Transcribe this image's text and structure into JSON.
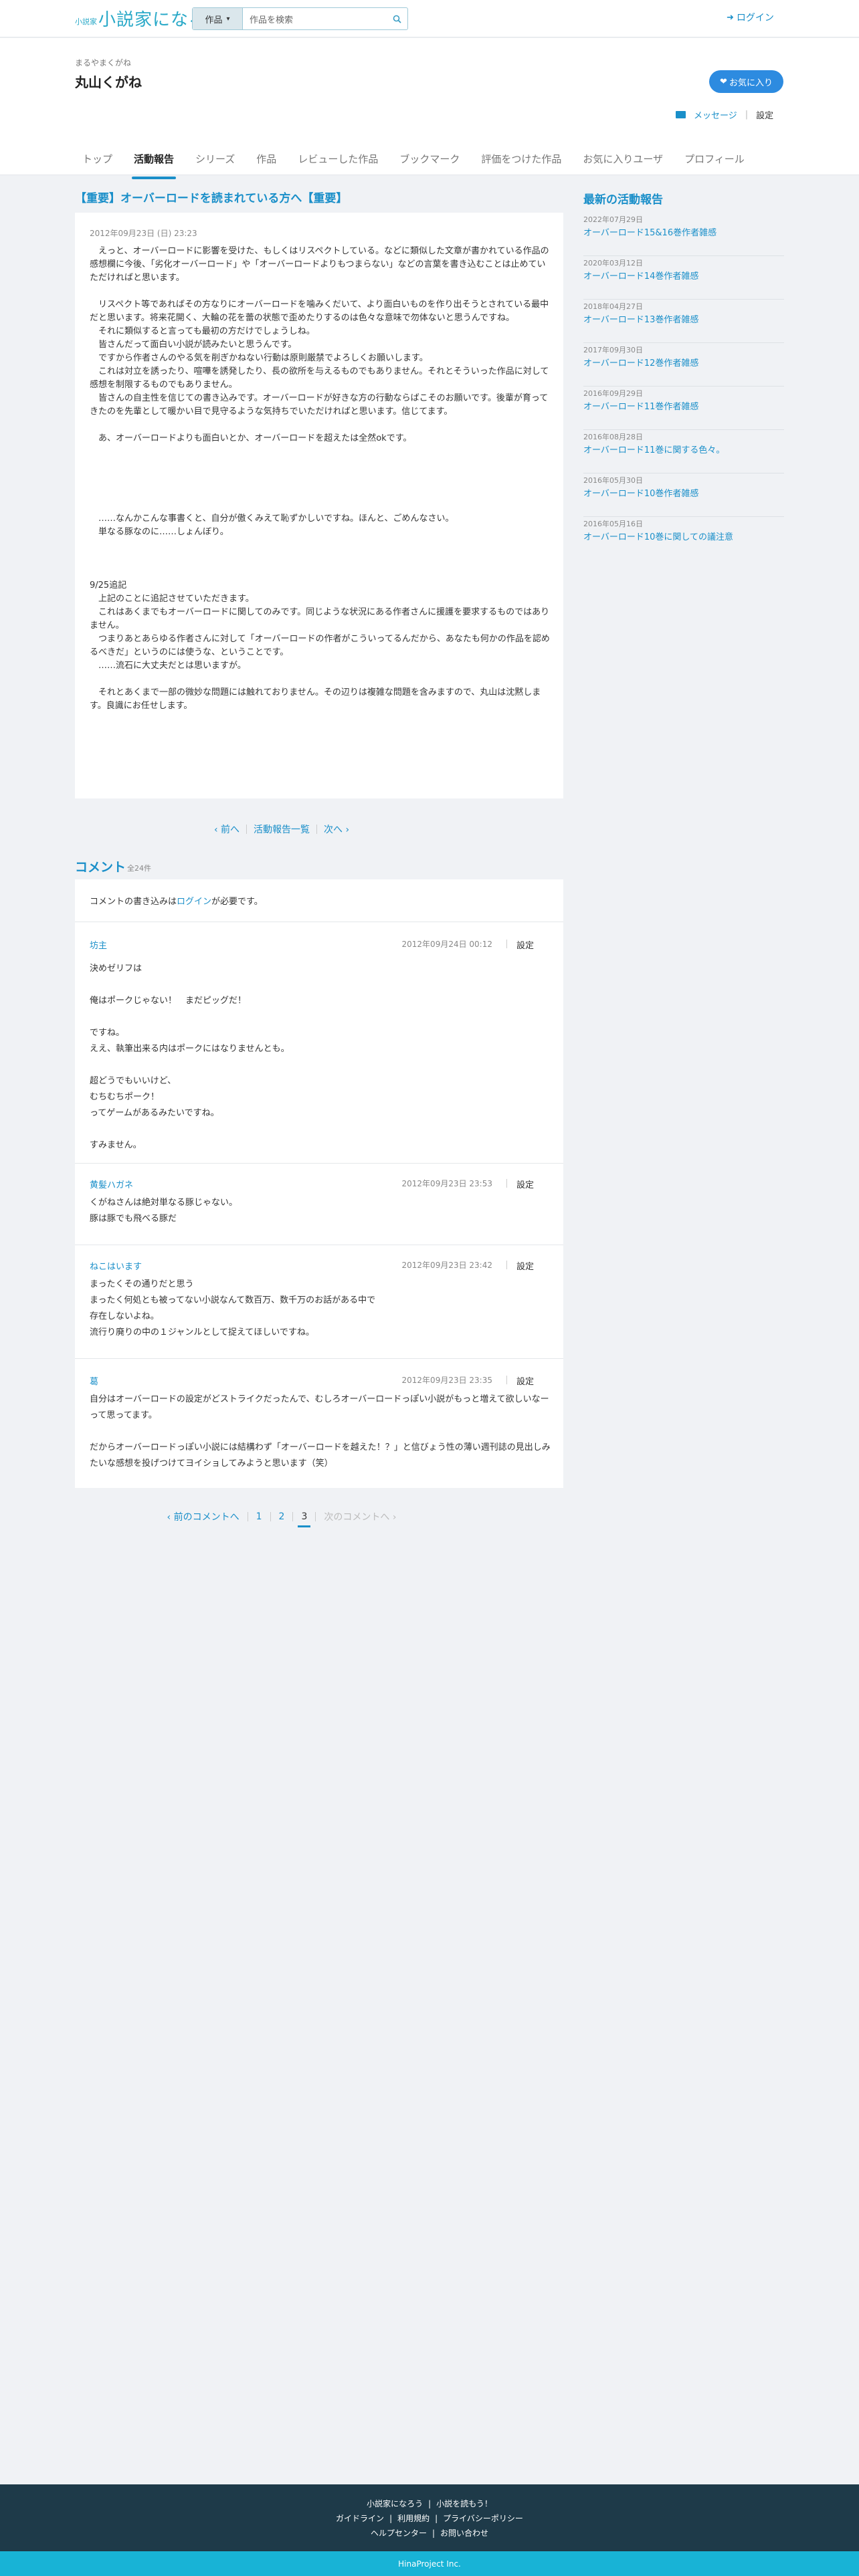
{
  "header": {
    "logo_small": "小説家",
    "logo_text": "小説家になろう",
    "search_category": "作品",
    "search_placeholder": "作品を検索",
    "login": "ログイン"
  },
  "user": {
    "kana": "まるやまくがね",
    "name": "丸山くがね",
    "favorite_button": "お気に入り",
    "message": "メッセージ",
    "settings": "設定"
  },
  "tabs": [
    {
      "label": "トップ",
      "active": false
    },
    {
      "label": "活動報告",
      "active": true
    },
    {
      "label": "シリーズ",
      "active": false
    },
    {
      "label": "作品",
      "active": false
    },
    {
      "label": "レビューした作品",
      "active": false
    },
    {
      "label": "ブックマーク",
      "active": false
    },
    {
      "label": "評価をつけた作品",
      "active": false
    },
    {
      "label": "お気に入りユーザ",
      "active": false
    },
    {
      "label": "プロフィール",
      "active": false
    }
  ],
  "article": {
    "title": "【重要】オーバーロードを読まれている方へ【重要】",
    "date": "2012年09月23日 (日) 23:23",
    "body": "　えっと、オーバーロードに影響を受けた、もしくはリスペクトしている。などに類似した文章が書かれている作品の感想欄に今後、「劣化オーバーロード」や「オーバーロードよりもつまらない」などの言葉を書き込むことは止めていただければと思います。\n\n　リスペクト等であればその方なりにオーバーロードを噛みくだいて、より面白いものを作り出そうとされている最中だと思います。将来花開く、大輪の花を蕾の状態で歪めたりするのは色々な意味で勿体ないと思うんですね。\n　それに類似すると言っても最初の方だけでしょうしね。\n　皆さんだって面白い小説が読みたいと思うんです。\n　ですから作者さんのやる気を削ぎかねない行動は原則厳禁でよろしくお願いします。\n　これは対立を誘ったり、喧嘩を誘発したり、長の欲所を与えるものでもありません。それとそういった作品に対して感想を制限するものでもありません。\n　皆さんの自主性を信じての書き込みです。オーバーロードが好きな方の行動ならばこそのお願いです。後輩が育ってきたのを先輩として暖かい目で見守るような気持ちでいただければと思います。信じてます。\n\n　あ、オーバーロードよりも面白いとか、オーバーロードを超えたは全然okです。\n\n\n\n\n\n　……なんかこんな事書くと、自分が傲くみえて恥ずかしいですね。ほんと、ごめんなさい。\n　単なる豚なのに……しょんぼり。\n\n\n\n9/25追記\n　上記のことに追記させていただきます。\n　これはあくまでもオーバーロードに関してのみです。同じような状況にある作者さんに援護を要求するものではありません。\n　つまりあとあらゆる作者さんに対して「オーバーロードの作者がこういってるんだから、あなたも何かの作品を認めるべきだ」というのには使うな、ということです。\n　……流石に大丈夫だとは思いますが。\n\n　それとあくまで一部の微妙な問題には触れておりません。その辺りは複雑な問題を含みますので、丸山は沈黙します。良識にお任せします。"
  },
  "pager": {
    "prev": "前へ",
    "list": "活動報告一覧",
    "next": "次へ"
  },
  "comments": {
    "title": "コメント",
    "count": "全24件",
    "login_notice_pre": "コメントの書き込みは",
    "login_link": "ログイン",
    "login_notice_post": "が必要です。",
    "settings_label": "設定",
    "items": [
      {
        "author": "坊主",
        "date": "2012年09月24日 00:12",
        "body": "決めゼリフは\n\n俺はポークじゃない！　まだピッグだ！\n\nですね。\nええ、執筆出来る内はポークにはなりませんとも。\n\n超どうでもいいけど、\nむちむちポーク！\nってゲームがあるみたいですね。\n\nすみません。"
      },
      {
        "author": "黄髪ハガネ",
        "date": "2012年09月23日 23:53",
        "body": "くがねさんは絶対単なる豚じゃない。\n豚は豚でも飛べる豚だ"
      },
      {
        "author": "ねこはいます",
        "date": "2012年09月23日 23:42",
        "body": "まったくその通りだと思う\nまったく何処とも被ってない小説なんて数百万、数千万のお話がある中で\n存在しないよね。\n流行り廃りの中の１ジャンルとして捉えてほしいですね。"
      },
      {
        "author": "葛",
        "date": "2012年09月23日 23:35",
        "body": "自分はオーバーロードの設定がどストライクだったんで、むしろオーバーロードっぽい小説がもっと増えて欲しいなーって思ってます。\n\nだからオーバーロードっぽい小説には結構わず「オーバーロードを越えた！？」と信びょう性の薄い週刊誌の見出しみたいな感想を投げつけてヨイショしてみようと思います（笑）"
      }
    ]
  },
  "comment_pager": {
    "prev": "前のコメントへ",
    "pages": [
      "1",
      "2",
      "3"
    ],
    "current": "3",
    "next": "次のコメントへ"
  },
  "sidebar": {
    "title": "最新の活動報告",
    "items": [
      {
        "date": "2022年07月29日",
        "title": "オーバーロード15&16巻作者雑感"
      },
      {
        "date": "2020年03月12日",
        "title": "オーバーロード14巻作者雑感"
      },
      {
        "date": "2018年04月27日",
        "title": "オーバーロード13巻作者雑感"
      },
      {
        "date": "2017年09月30日",
        "title": "オーバーロード12巻作者雑感"
      },
      {
        "date": "2016年09月29日",
        "title": "オーバーロード11巻作者雑感"
      },
      {
        "date": "2016年08月28日",
        "title": "オーバーロード11巻に関する色々。"
      },
      {
        "date": "2016年05月30日",
        "title": "オーバーロード10巻作者雑感"
      },
      {
        "date": "2016年05月16日",
        "title": "オーバーロード10巻に関しての議注意"
      }
    ]
  },
  "footer": {
    "links_row1": [
      "小説家になろう",
      "小説を読もう！"
    ],
    "links_row2": [
      "ガイドライン",
      "利用規約",
      "プライバシーポリシー"
    ],
    "links_row3": [
      "ヘルプセンター",
      "お問い合わせ"
    ],
    "company": "HinaProject Inc."
  }
}
